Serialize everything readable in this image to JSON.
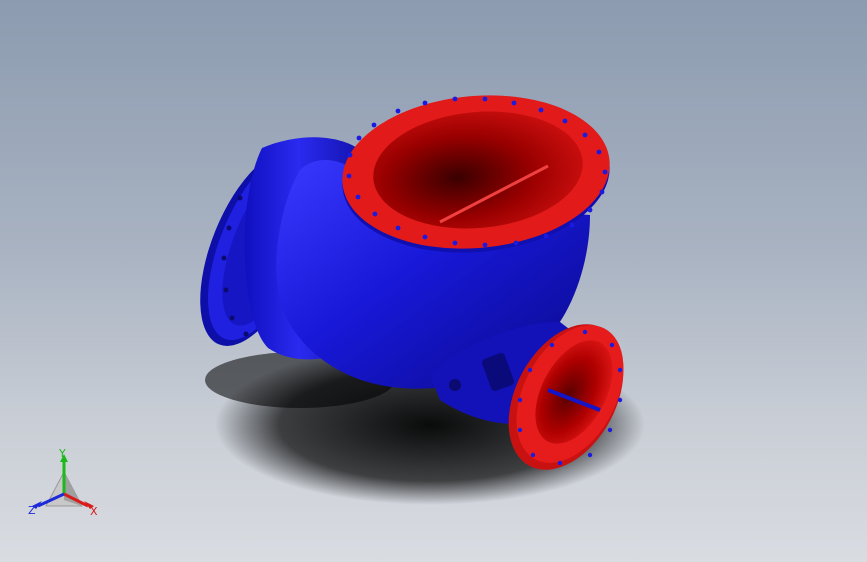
{
  "viewport": {
    "background_top": "#8c9bb0",
    "background_bottom": "#d9dce1"
  },
  "model": {
    "body_color": "#1414d2",
    "flange_color": "#e21a1a",
    "inner_color": "#a00000",
    "bolt_hole_color": "#1a1ae0"
  },
  "triad": {
    "x_label": "X",
    "y_label": "Y",
    "z_label": "Z",
    "x_color": "#d81c1c",
    "y_color": "#1cb81c",
    "z_color": "#1c2ad8"
  }
}
